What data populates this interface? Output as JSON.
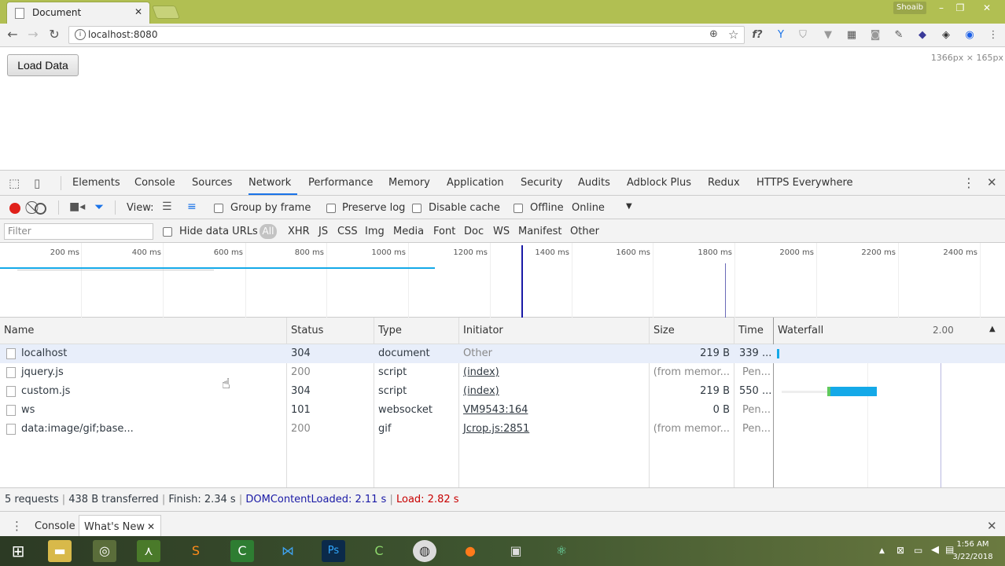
{
  "browser": {
    "tab_title": "Document",
    "user": "Shoaib",
    "url": "localhost:8080"
  },
  "page": {
    "load_button": "Load Data",
    "dimensions": "1366px × 165px"
  },
  "devtools": {
    "tabs": [
      "Elements",
      "Console",
      "Sources",
      "Network",
      "Performance",
      "Memory",
      "Application",
      "Security",
      "Audits",
      "Adblock Plus",
      "Redux",
      "HTTPS Everywhere"
    ],
    "active_tab": "Network",
    "toolbar": {
      "view_label": "View:",
      "group_by_frame": "Group by frame",
      "preserve_log": "Preserve log",
      "disable_cache": "Disable cache",
      "offline": "Offline",
      "throttle": "Online"
    },
    "filter": {
      "placeholder": "Filter",
      "hide_data_urls": "Hide data URLs",
      "types": [
        "All",
        "XHR",
        "JS",
        "CSS",
        "Img",
        "Media",
        "Font",
        "Doc",
        "WS",
        "Manifest",
        "Other"
      ]
    },
    "overview_ticks": [
      "200 ms",
      "400 ms",
      "600 ms",
      "800 ms",
      "1000 ms",
      "1200 ms",
      "1400 ms",
      "1600 ms",
      "1800 ms",
      "2000 ms",
      "2200 ms",
      "2400 ms"
    ],
    "columns": [
      "Name",
      "Status",
      "Type",
      "Initiator",
      "Size",
      "Time",
      "Waterfall"
    ],
    "waterfall_marker": "2.00",
    "rows": [
      {
        "name": "localhost",
        "status": "304",
        "type": "document",
        "initiator": "Other",
        "size": "219 B",
        "time": "339 ..."
      },
      {
        "name": "jquery.js",
        "status": "200",
        "type": "script",
        "initiator": "(index)",
        "size": "(from memor...",
        "time": "Pen..."
      },
      {
        "name": "custom.js",
        "status": "304",
        "type": "script",
        "initiator": "(index)",
        "size": "219 B",
        "time": "550 ..."
      },
      {
        "name": "ws",
        "status": "101",
        "type": "websocket",
        "initiator": "VM9543:164",
        "size": "0 B",
        "time": "Pen..."
      },
      {
        "name": "data:image/gif;base...",
        "status": "200",
        "type": "gif",
        "initiator": "Jcrop.js:2851",
        "size": "(from memor...",
        "time": "Pen..."
      }
    ],
    "status": {
      "requests": "5 requests",
      "transferred": "438 B transferred",
      "finish": "Finish: 2.34 s",
      "dcl": "DOMContentLoaded: 2.11 s",
      "load": "Load: 2.82 s"
    },
    "drawer_tabs": [
      "Console",
      "What's New"
    ]
  },
  "taskbar": {
    "time": "1:56 AM",
    "date": "3/22/2018"
  },
  "colors": {
    "dcl": "#1a1aa6",
    "load": "#c80000",
    "accent": "#1a73e8",
    "waterfall": "#14a9e8"
  }
}
